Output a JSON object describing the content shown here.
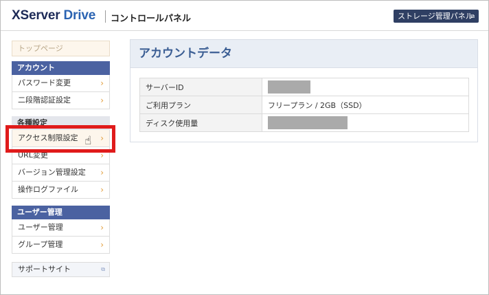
{
  "header": {
    "logo_x": "XServer",
    "logo_drive": "Drive",
    "panel_title": "コントロールパネル",
    "storage_button": "ストレージ管理パネル",
    "external_icon": "external-link-icon"
  },
  "sidebar": {
    "top_page": "トップページ",
    "account_heading": "アカウント",
    "account_items": [
      "パスワード変更",
      "二段階認証設定"
    ],
    "settings_heading": "各種設定",
    "settings_items": [
      "アクセス制限設定",
      "URL変更",
      "バージョン管理設定",
      "操作ログファイル"
    ],
    "user_heading": "ユーザー管理",
    "user_items": [
      "ユーザー管理",
      "グループ管理"
    ],
    "support": "サポートサイト",
    "chevron": "›"
  },
  "content": {
    "title": "アカウントデータ",
    "rows": [
      {
        "label": "サーバーID",
        "value": ""
      },
      {
        "label": "ご利用プラン",
        "value": "フリープラン / 2GB（SSD）"
      },
      {
        "label": "ディスク使用量",
        "value": ""
      }
    ]
  },
  "colors": {
    "highlight": "#e01b1b",
    "section_header": "#4b62a1",
    "accent_chevron": "#e29d3b"
  }
}
